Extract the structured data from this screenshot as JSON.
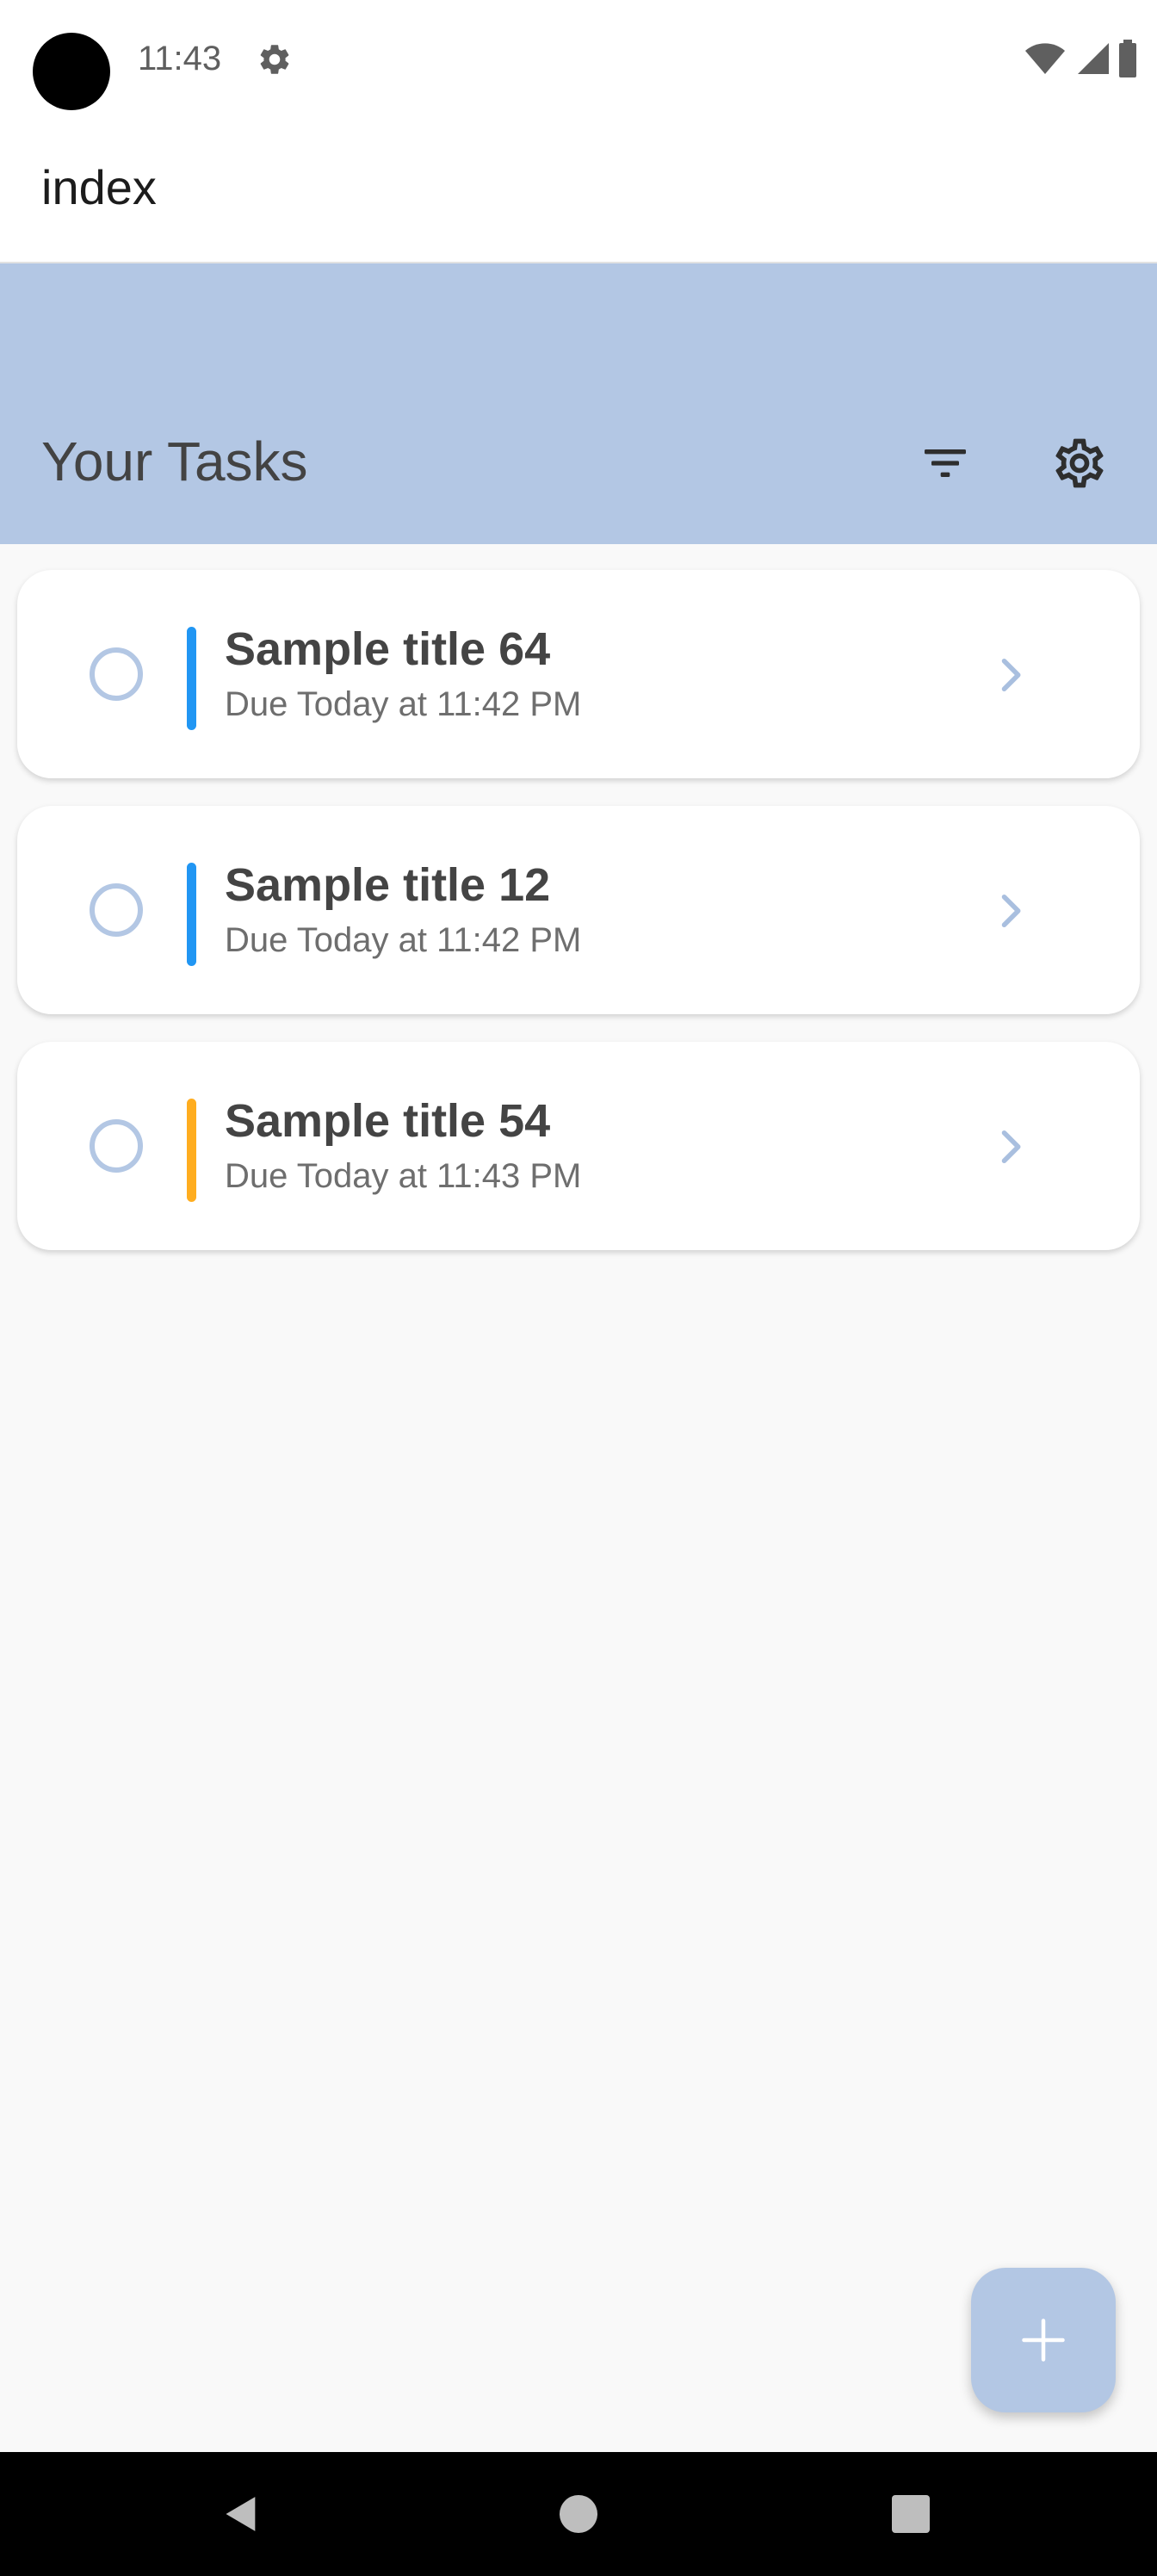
{
  "status_bar": {
    "time": "11:43",
    "icons": [
      "camera-cutout",
      "gear-icon",
      "wifi-icon",
      "signal-icon",
      "battery-icon"
    ]
  },
  "app_bar": {
    "title": "index"
  },
  "header": {
    "title": "Your Tasks",
    "filter_icon": "filter-icon",
    "settings_icon": "settings-icon",
    "background_color": "#B3C7E4"
  },
  "tasks": [
    {
      "title": "Sample title 64",
      "due": "Due Today at 11:42 PM",
      "priority_color": "#2196F3"
    },
    {
      "title": "Sample title 12",
      "due": "Due Today at 11:42 PM",
      "priority_color": "#2196F3"
    },
    {
      "title": "Sample title 54",
      "due": "Due Today at 11:43 PM",
      "priority_color": "#FFAD1F"
    }
  ],
  "fab": {
    "icon": "plus-icon"
  },
  "navigation": {
    "icons": [
      "back-icon",
      "home-icon",
      "recents-icon"
    ]
  },
  "colors": {
    "accent": "#B3C7E4",
    "background": "#F9F9F9",
    "card": "#FFFFFF",
    "title_text": "#444444",
    "secondary_text": "#6E6E6E"
  }
}
